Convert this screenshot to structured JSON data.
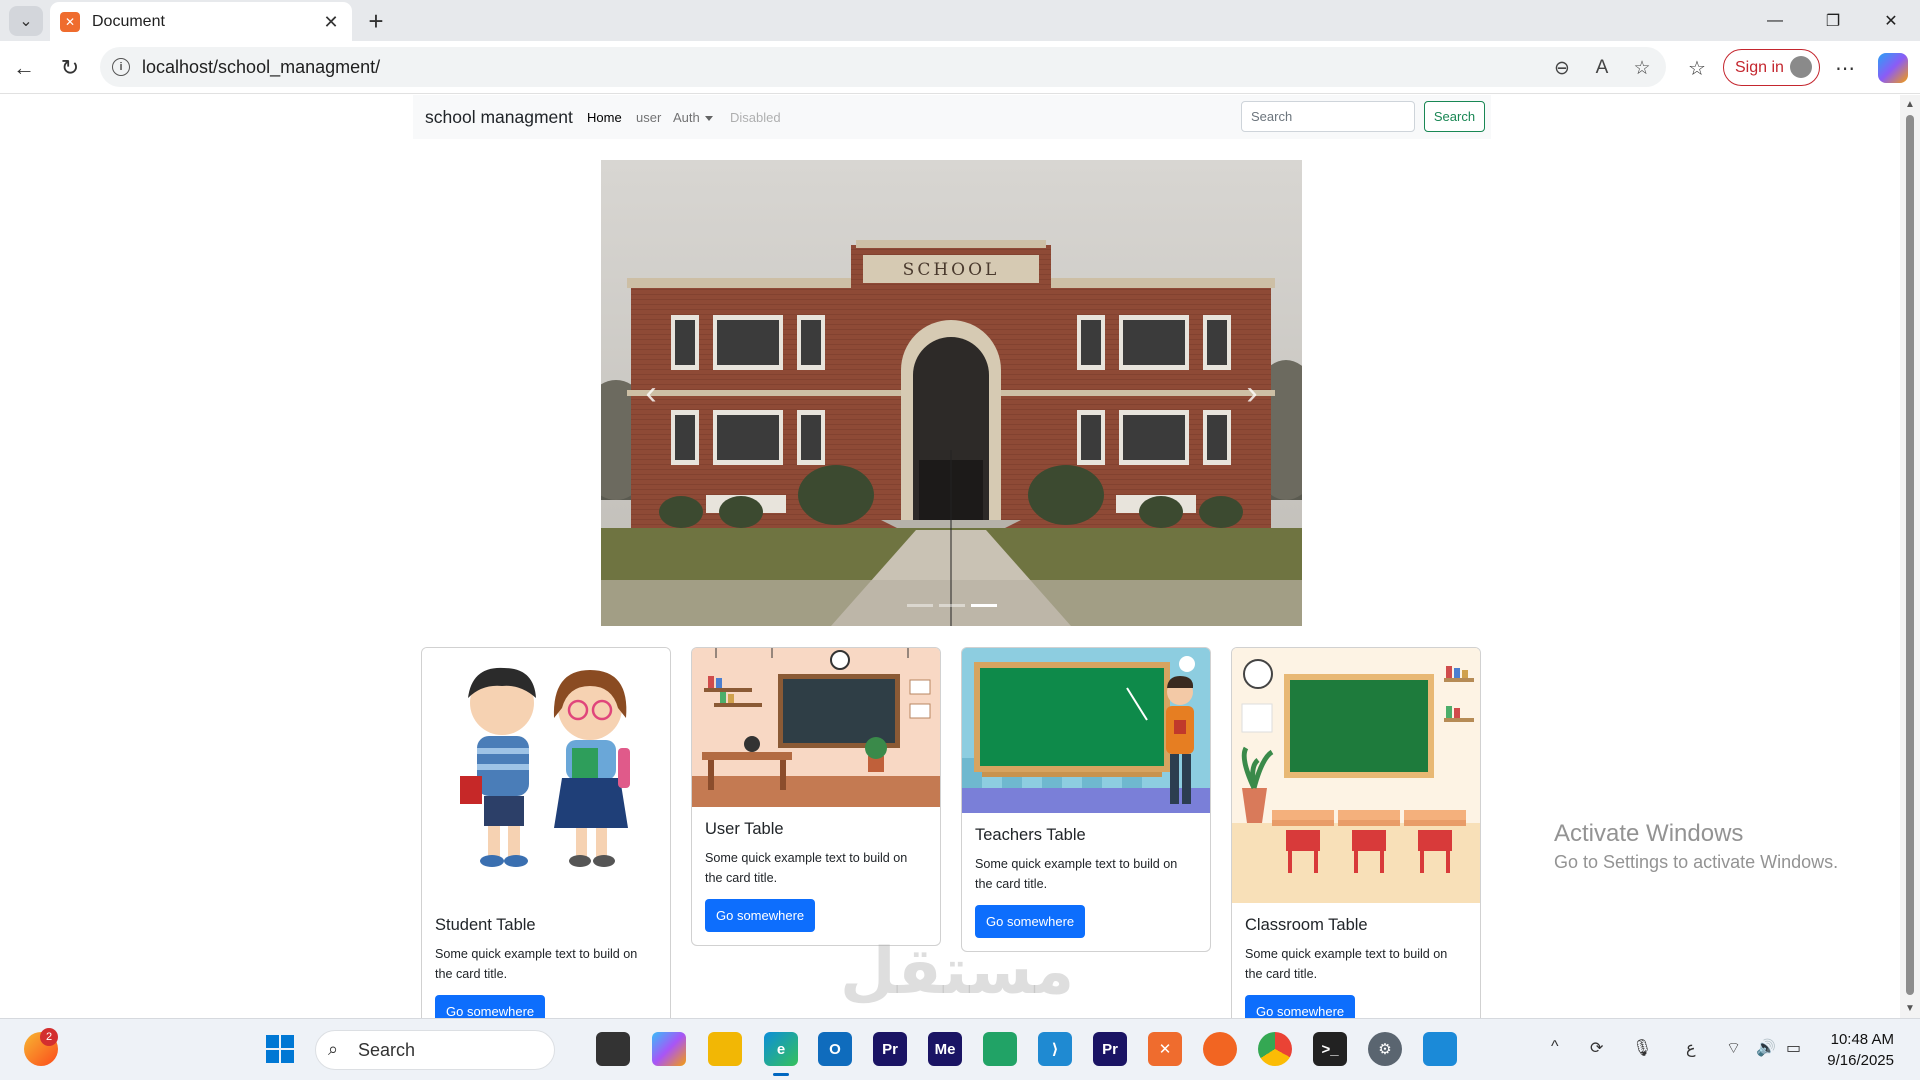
{
  "browser": {
    "tab_title": "Document",
    "tab_favicon": "xampp-icon",
    "address": "localhost/school_managment/",
    "signin_label": "Sign in"
  },
  "site": {
    "brand": "school managment",
    "nav": [
      {
        "label": "Home",
        "state": "active"
      },
      {
        "label": "user",
        "state": "normal"
      },
      {
        "label": "Auth",
        "state": "dropdown"
      },
      {
        "label": "Disabled",
        "state": "disabled"
      }
    ],
    "search_placeholder": "Search",
    "search_button": "Search"
  },
  "carousel": {
    "sign_text": "SCHOOL",
    "indicators": 3,
    "active_index": 2
  },
  "cards": [
    {
      "title": "Student Table",
      "text": "Some quick example text to build on the card title.",
      "button": "Go somewhere"
    },
    {
      "title": "User Table",
      "text": "Some quick example text to build on the card title.",
      "button": "Go somewhere"
    },
    {
      "title": "Teachers Table",
      "text": "Some quick example text to build on the card title.",
      "button": "Go somewhere"
    },
    {
      "title": "Classroom Table",
      "text": "Some quick example text to build on the card title.",
      "button": "Go somewhere"
    }
  ],
  "overlay": {
    "activate_title": "Activate Windows",
    "activate_sub": "Go to Settings to activate Windows."
  },
  "taskbar": {
    "search_label": "Search",
    "time": "10:48 AM",
    "date": "9/16/2025",
    "notification_count": "2",
    "keyboard_lang": "ع"
  },
  "colors": {
    "primary_button": "#0d6efd",
    "success_outline": "#198754",
    "navbar_bg": "#f8f9fa"
  }
}
